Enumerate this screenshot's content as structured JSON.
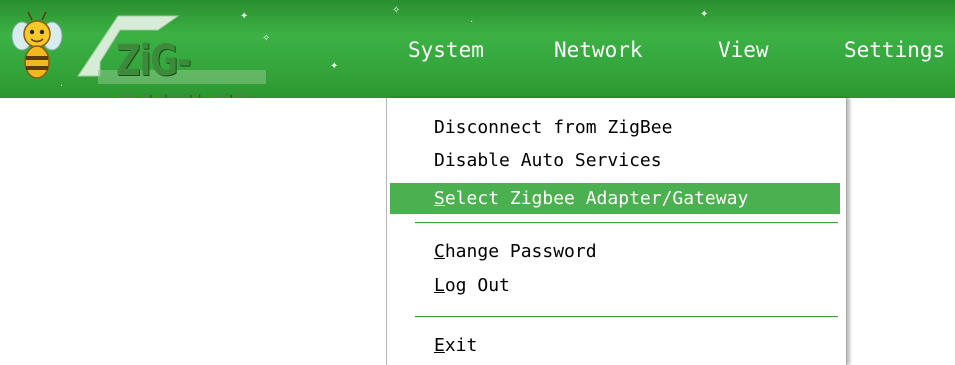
{
  "app": {
    "logo_text": "ZiG-BUTLER",
    "logo_icon": "bee-mascot-icon"
  },
  "menubar": {
    "items": [
      {
        "label": "System"
      },
      {
        "label": "Network"
      },
      {
        "label": "View"
      },
      {
        "label": "Settings"
      }
    ]
  },
  "dropdown": {
    "items": [
      {
        "label": "Disconnect from ZigBee",
        "mnemonic": ""
      },
      {
        "label": "Disable Auto Services",
        "mnemonic": ""
      },
      {
        "label": "elect Zigbee Adapter/Gateway",
        "mnemonic": "S",
        "selected": true
      },
      {
        "label": "hange Password",
        "mnemonic": "C"
      },
      {
        "label": "og Out",
        "mnemonic": "L"
      },
      {
        "label": "xit",
        "mnemonic": "E"
      }
    ]
  },
  "colors": {
    "header_green": "#3cb144",
    "highlight_green": "#4bb04f",
    "menu_text": "#ffffff"
  }
}
